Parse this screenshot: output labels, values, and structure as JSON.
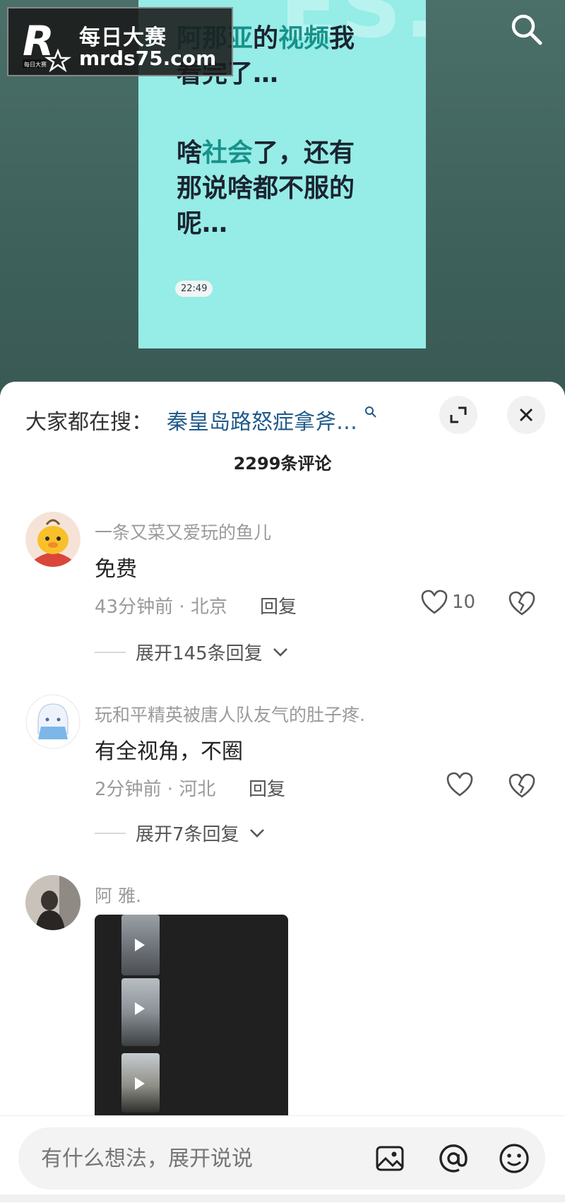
{
  "watermark": {
    "site": "每日大赛",
    "domain": "mrds75.com"
  },
  "video": {
    "lines": [
      {
        "parts": [
          {
            "t": "阿那亚",
            "hl": true
          },
          {
            "t": "的",
            "hl": false
          },
          {
            "t": "视频",
            "hl": true
          },
          {
            "t": "我",
            "hl": false
          }
        ]
      },
      {
        "parts": [
          {
            "t": "看完了…",
            "hl": false
          }
        ]
      },
      {
        "parts": [
          {
            "t": "啥",
            "hl": false
          },
          {
            "t": "社会",
            "hl": true
          },
          {
            "t": "了，还有",
            "hl": false
          }
        ]
      },
      {
        "parts": [
          {
            "t": "那说啥都不服的",
            "hl": false
          }
        ]
      },
      {
        "parts": [
          {
            "t": "呢…",
            "hl": false
          }
        ]
      }
    ],
    "timestamp": "22:49"
  },
  "sheet": {
    "search_label": "大家都在搜：",
    "search_query": "秦皇岛路怒症拿斧…",
    "comment_count": "2299条评论"
  },
  "comments": [
    {
      "name": "一条又菜又爱玩的鱼儿",
      "text": "免费",
      "time_location": "43分钟前 · 北京",
      "reply": "回复",
      "likes": "10",
      "expand": "展开145条回复"
    },
    {
      "name": "玩和平精英被唐人队友气的肚子疼.",
      "text": "有全视角，不圈",
      "time_location": "2分钟前 · 河北",
      "reply": "回复",
      "likes": "",
      "expand": "展开7条回复"
    },
    {
      "name": "阿 雅."
    }
  ],
  "input": {
    "placeholder": "有什么想法，展开说说"
  },
  "icons": {
    "search": "search-icon",
    "expand": "expand-icon",
    "close": "close-icon",
    "like": "heart-icon",
    "dislike": "broken-heart-icon",
    "image": "image-icon",
    "mention": "at-icon",
    "emoji": "emoji-icon"
  },
  "colors": {
    "accent_highlight": "#17928a",
    "search_query": "#1f5a8a",
    "card_bg": "#96ece6"
  }
}
